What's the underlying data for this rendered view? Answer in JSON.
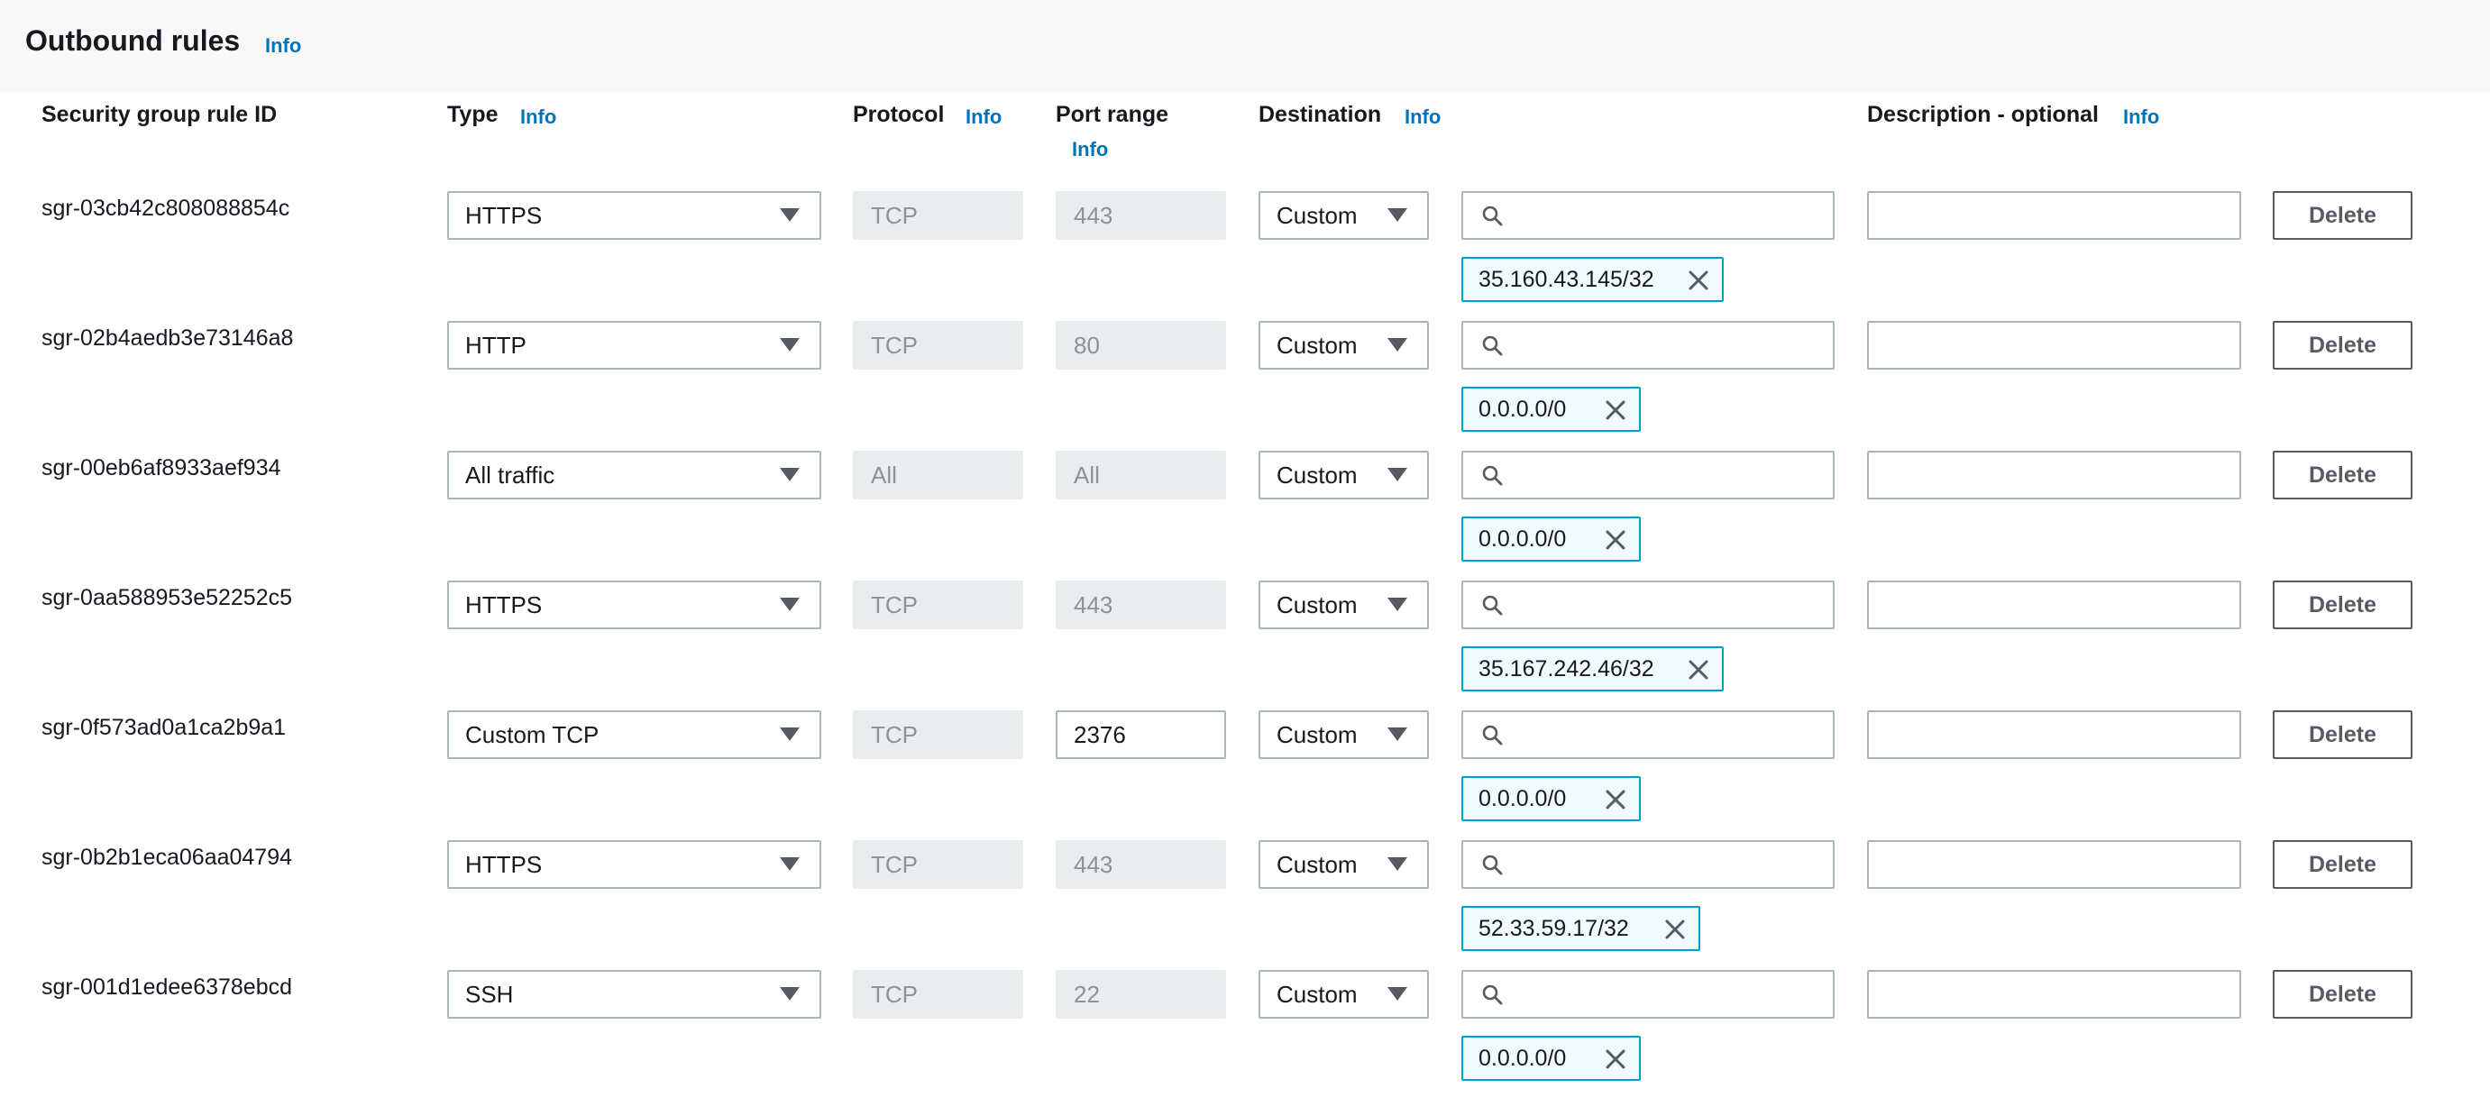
{
  "section": {
    "title": "Outbound rules",
    "info": "Info"
  },
  "columns": {
    "rule_id": "Security group rule ID",
    "type": "Type",
    "type_info": "Info",
    "protocol": "Protocol",
    "protocol_info": "Info",
    "port_range": "Port range",
    "port_range_info": "Info",
    "destination": "Destination",
    "destination_info": "Info",
    "description": "Description - optional",
    "description_info": "Info"
  },
  "rules": [
    {
      "id": "sgr-03cb42c808088854c",
      "type": "HTTPS",
      "protocol": "TCP",
      "port_range": "443",
      "port_editable": false,
      "destination_type": "Custom",
      "destination_cidr": "35.160.43.145/32",
      "description": "",
      "delete_label": "Delete"
    },
    {
      "id": "sgr-02b4aedb3e73146a8",
      "type": "HTTP",
      "protocol": "TCP",
      "port_range": "80",
      "port_editable": false,
      "destination_type": "Custom",
      "destination_cidr": "0.0.0.0/0",
      "description": "",
      "delete_label": "Delete"
    },
    {
      "id": "sgr-00eb6af8933aef934",
      "type": "All traffic",
      "protocol": "All",
      "port_range": "All",
      "port_editable": false,
      "destination_type": "Custom",
      "destination_cidr": "0.0.0.0/0",
      "description": "",
      "delete_label": "Delete"
    },
    {
      "id": "sgr-0aa588953e52252c5",
      "type": "HTTPS",
      "protocol": "TCP",
      "port_range": "443",
      "port_editable": false,
      "destination_type": "Custom",
      "destination_cidr": "35.167.242.46/32",
      "description": "",
      "delete_label": "Delete"
    },
    {
      "id": "sgr-0f573ad0a1ca2b9a1",
      "type": "Custom TCP",
      "protocol": "TCP",
      "port_range": "2376",
      "port_editable": true,
      "destination_type": "Custom",
      "destination_cidr": "0.0.0.0/0",
      "description": "",
      "delete_label": "Delete"
    },
    {
      "id": "sgr-0b2b1eca06aa04794",
      "type": "HTTPS",
      "protocol": "TCP",
      "port_range": "443",
      "port_editable": false,
      "destination_type": "Custom",
      "destination_cidr": "52.33.59.17/32",
      "description": "",
      "delete_label": "Delete"
    },
    {
      "id": "sgr-001d1edee6378ebcd",
      "type": "SSH",
      "protocol": "TCP",
      "port_range": "22",
      "port_editable": false,
      "destination_type": "Custom",
      "destination_cidr": "0.0.0.0/0",
      "description": "",
      "delete_label": "Delete"
    }
  ],
  "icons": {
    "dropdown": "caret-down-icon",
    "search": "search-icon",
    "remove": "close-icon"
  },
  "colors": {
    "info_link": "#0073bb",
    "token_border": "#00a1c9",
    "token_bg": "#f1faff",
    "disabled_bg": "#eaeded"
  }
}
